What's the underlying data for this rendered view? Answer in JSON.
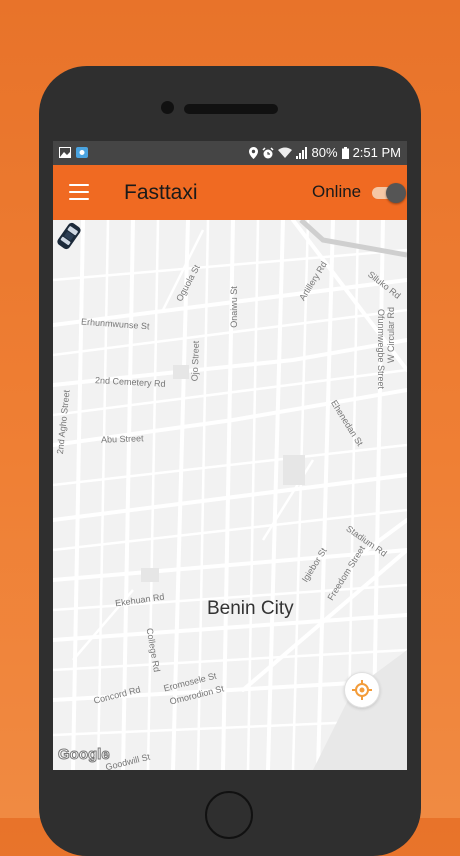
{
  "statusbar": {
    "battery": "80%",
    "time": "2:51 PM",
    "icons": [
      "gallery-icon",
      "app-icon",
      "location-icon",
      "alarm-icon",
      "wifi-icon",
      "signal-icon",
      "battery-icon"
    ]
  },
  "appbar": {
    "title": "Fasttaxi",
    "online_label": "Online",
    "online": true,
    "accent": "#f06a22"
  },
  "map": {
    "city": "Benin City",
    "streets": [
      "Oguola St",
      "Onaiwu St",
      "Artillery Rd",
      "Siluko Rd",
      "Erhunmwunse St",
      "Ofunmwegbe Street",
      "W Circular Rd",
      "Ojo Street",
      "2nd Cemetery Rd",
      "2nd Agho Street",
      "Ehenedan St",
      "Abu Street",
      "Stadium Rd",
      "Igiebor St",
      "Freedom Street",
      "Ekehuan Rd",
      "College Rd",
      "Concord Rd",
      "Eromosele St",
      "Omorodion St",
      "Goodwill St"
    ],
    "attribution": "Google"
  }
}
